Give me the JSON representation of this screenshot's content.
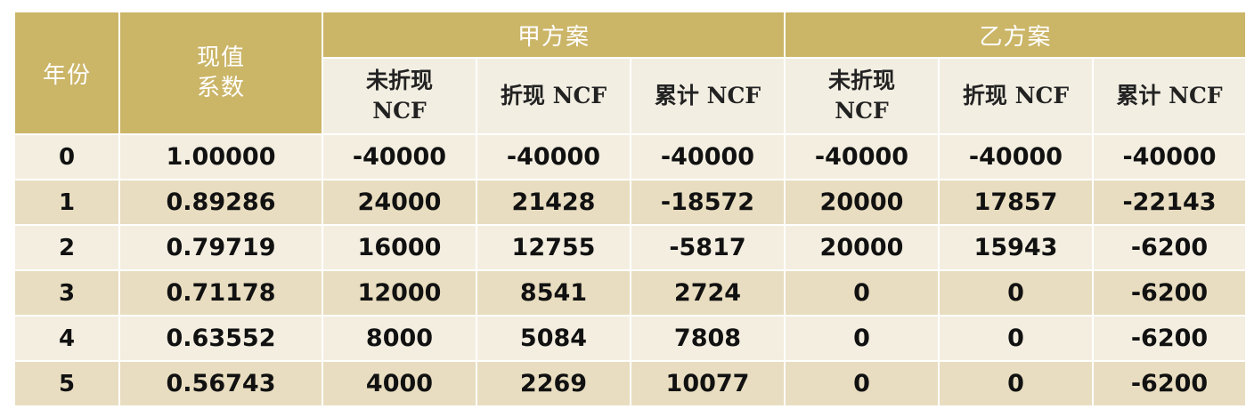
{
  "table": {
    "headers": {
      "year": "年份",
      "pv_factor": "现值\n系数",
      "plan_a": "甲方案",
      "plan_b": "乙方案",
      "plan_a_cols": [
        "未折现\nNCF",
        "折现 NCF",
        "累计 NCF"
      ],
      "plan_b_cols": [
        "未折现\nNCF",
        "折现 NCF",
        "累计 NCF"
      ]
    },
    "rows": [
      [
        "0",
        "1.00000",
        "-40000",
        "-40000",
        "-40000",
        "-40000",
        "-40000",
        "-40000"
      ],
      [
        "1",
        "0.89286",
        "24000",
        "21428",
        "-18572",
        "20000",
        "17857",
        "-22143"
      ],
      [
        "2",
        "0.79719",
        "16000",
        "12755",
        "-5817",
        "20000",
        "15943",
        "-6200"
      ],
      [
        "3",
        "0.71178",
        "12000",
        "8541",
        "2724",
        "0",
        "0",
        "-6200"
      ],
      [
        "4",
        "0.63552",
        "8000",
        "5084",
        "7808",
        "0",
        "0",
        "-6200"
      ],
      [
        "5",
        "0.56743",
        "4000",
        "2269",
        "10077",
        "0",
        "0",
        "-6200"
      ]
    ]
  },
  "colors": {
    "header_gold": "#cbb567",
    "subheader_bg": "#f2eee2",
    "row_light": "#f3eee0",
    "row_dark": "#e8ddc0"
  }
}
